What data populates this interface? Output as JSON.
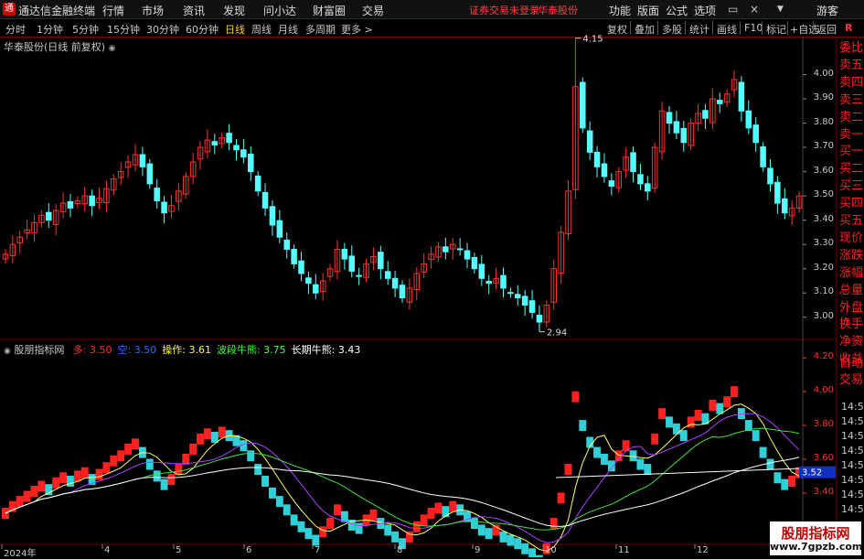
{
  "titlebar": {
    "app": "通达信金融终端",
    "menus": [
      "行情",
      "市场",
      "资讯",
      "发现",
      "问小达",
      "财富圈",
      "交易"
    ],
    "status": "证券交易未登录",
    "stock_name": "华泰股份",
    "tools": [
      "功能",
      "版面",
      "公式",
      "选项"
    ],
    "user": "游客"
  },
  "toolbar": {
    "periods": [
      "分时",
      "1分钟",
      "5分钟",
      "15分钟",
      "30分钟",
      "60分钟",
      "日线",
      "周线",
      "月线",
      "多周期",
      "更多 >"
    ],
    "active_period": "日线",
    "right": [
      "复权",
      "叠加",
      "多股",
      "统计",
      "画线",
      "F10",
      "标记",
      "+自选",
      "返回"
    ]
  },
  "main_chart": {
    "title": "华泰股份(日线 前复权)",
    "high_label": "4.15",
    "low_label": "2.94",
    "y_ticks": [
      "4.00",
      "3.90",
      "3.80",
      "3.70",
      "3.60",
      "3.50",
      "3.40",
      "3.30",
      "3.20",
      "3.10",
      "3.00"
    ]
  },
  "right_panel": {
    "items": [
      "委比",
      "卖五",
      "卖四",
      "卖三",
      "卖二",
      "卖一",
      "买一",
      "买二",
      "买三",
      "买四",
      "买五",
      "现价",
      "涨跌",
      "涨幅",
      "总量",
      "外盘",
      "换手",
      "净资",
      "收益"
    ],
    "lower_items": [
      "自动",
      "交易"
    ],
    "times": [
      "14:55",
      "14:56",
      "14:56",
      "14:56",
      "14:56",
      "14:56",
      "14:56",
      "14:56"
    ]
  },
  "indicator": {
    "name": "股朋指标网",
    "items": [
      {
        "label": "多: 3.50",
        "color": "#ff3030"
      },
      {
        "label": "空: 3.50",
        "color": "#3070ff"
      },
      {
        "label": "操作: 3.61",
        "color": "#ffff40"
      },
      {
        "label": "波段牛熊: 3.75",
        "color": "#40ff40"
      },
      {
        "label": "长期牛熊: 3.43",
        "color": "#ffffff"
      }
    ],
    "y_ticks": [
      "4.20",
      "4.00",
      "3.80",
      "3.60",
      "3.40",
      "3.20"
    ],
    "current_badge": "3.52"
  },
  "x_axis": [
    "2024年",
    "4",
    "5",
    "6",
    "7",
    "8",
    "9",
    "10",
    "11",
    "12"
  ],
  "watermark": {
    "title": "股朋指标网",
    "url": "www.7gpzb.com"
  },
  "chart_data": {
    "type": "candlestick",
    "closes": [
      3.26,
      3.3,
      3.33,
      3.36,
      3.39,
      3.42,
      3.4,
      3.44,
      3.47,
      3.45,
      3.48,
      3.5,
      3.46,
      3.49,
      3.53,
      3.57,
      3.6,
      3.64,
      3.67,
      3.62,
      3.55,
      3.48,
      3.43,
      3.46,
      3.52,
      3.58,
      3.64,
      3.7,
      3.73,
      3.71,
      3.74,
      3.72,
      3.69,
      3.66,
      3.6,
      3.52,
      3.45,
      3.38,
      3.33,
      3.28,
      3.22,
      3.18,
      3.14,
      3.1,
      3.15,
      3.2,
      3.28,
      3.24,
      3.19,
      3.17,
      3.22,
      3.25,
      3.2,
      3.16,
      3.12,
      3.08,
      3.12,
      3.18,
      3.22,
      3.26,
      3.29,
      3.27,
      3.3,
      3.28,
      3.24,
      3.2,
      3.16,
      3.14,
      3.16,
      3.12,
      3.1,
      3.08,
      3.05,
      3.02,
      2.98,
      3.05,
      3.2,
      3.35,
      3.52,
      3.95,
      3.78,
      3.68,
      3.62,
      3.58,
      3.54,
      3.6,
      3.66,
      3.6,
      3.55,
      3.52,
      3.7,
      3.85,
      3.8,
      3.76,
      3.72,
      3.8,
      3.84,
      3.82,
      3.9,
      3.88,
      3.92,
      3.98,
      3.85,
      3.78,
      3.72,
      3.62,
      3.55,
      3.47,
      3.43,
      3.45,
      3.5
    ],
    "high": 4.15,
    "low": 2.94,
    "ylim": [
      2.95,
      4.1
    ],
    "indicator_ylim": [
      3.15,
      4.25
    ]
  }
}
